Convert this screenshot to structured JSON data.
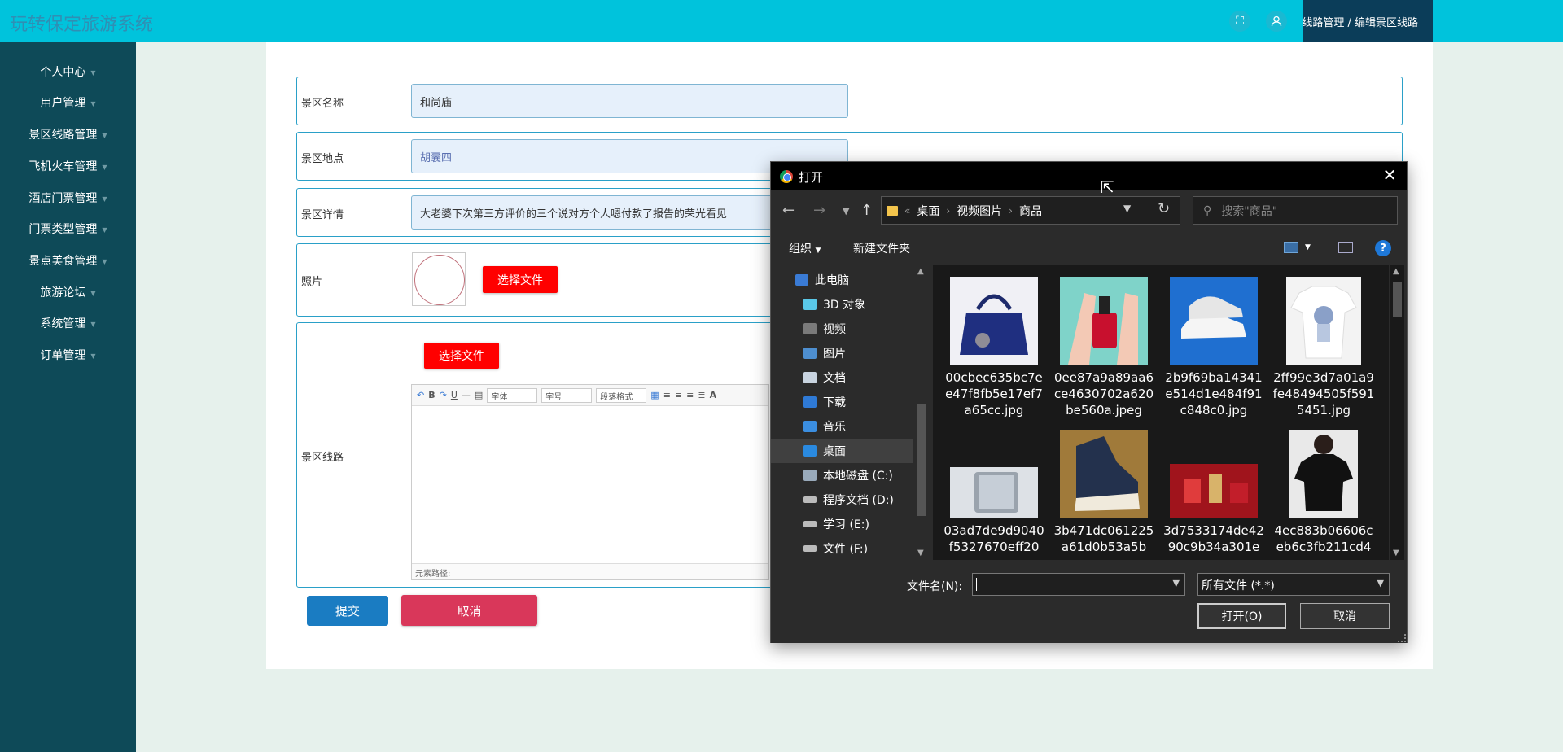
{
  "app": {
    "title": "玩转保定旅游系统"
  },
  "header": {
    "breadcrumb": "景区线路管理 / 编辑景区线路",
    "icons": [
      "fullscreen-icon",
      "user-icon"
    ]
  },
  "sidebar": {
    "items": [
      {
        "label": "个人中心"
      },
      {
        "label": "用户管理"
      },
      {
        "label": "景区线路管理"
      },
      {
        "label": "飞机火车管理"
      },
      {
        "label": "酒店门票管理"
      },
      {
        "label": "门票类型管理"
      },
      {
        "label": "景点美食管理"
      },
      {
        "label": "旅游论坛"
      },
      {
        "label": "系统管理"
      },
      {
        "label": "订单管理"
      }
    ]
  },
  "form": {
    "name": {
      "label": "景区名称",
      "value": "和尚庙"
    },
    "location": {
      "label": "景区地点",
      "value": "胡囊四"
    },
    "detail": {
      "label": "景区详情",
      "value": "大老婆下次第三方评价的三个说对方个人嗯付款了报告的荣光看见"
    },
    "photo": {
      "label": "照片",
      "choose_label": "选择文件"
    },
    "route": {
      "label": "景区线路",
      "choose_label": "选择文件",
      "toolbar": {
        "font": "字体",
        "size": "字号",
        "format": "段落格式"
      },
      "status": "元素路径:"
    },
    "submit_label": "提交",
    "cancel_label": "取消"
  },
  "dialog": {
    "title": "打开",
    "path": [
      "桌面",
      "视频图片",
      "商品"
    ],
    "search_placeholder": "搜索\"商品\"",
    "organize_label": "组织",
    "new_folder_label": "新建文件夹",
    "nav": [
      {
        "label": "此电脑",
        "icon": "computer-icon",
        "color": "#3a7bd5"
      },
      {
        "label": "3D 对象",
        "icon": "3d-objects-icon",
        "color": "#5ac8e8"
      },
      {
        "label": "视频",
        "icon": "video-icon",
        "color": "#7a7a7a"
      },
      {
        "label": "图片",
        "icon": "pictures-icon",
        "color": "#4e8fd0"
      },
      {
        "label": "文档",
        "icon": "documents-icon",
        "color": "#c9d4e0"
      },
      {
        "label": "下载",
        "icon": "download-icon",
        "color": "#2f7ad6"
      },
      {
        "label": "音乐",
        "icon": "music-icon",
        "color": "#3b8ee0"
      },
      {
        "label": "桌面",
        "icon": "desktop-icon",
        "color": "#2a8ae0"
      },
      {
        "label": "本地磁盘 (C:)",
        "icon": "drive-c-icon",
        "color": "#9ab"
      },
      {
        "label": "程序文档 (D:)",
        "icon": "drive-icon",
        "color": "#bbb"
      },
      {
        "label": "学习 (E:)",
        "icon": "drive-icon",
        "color": "#bbb"
      },
      {
        "label": "文件 (F:)",
        "icon": "drive-icon",
        "color": "#bbb"
      }
    ],
    "selected_nav": 7,
    "files": [
      {
        "name": "00cbec635bc7ee47f8fb5e17ef7a65cc.jpg",
        "thumb": "handbag",
        "bg": "#f0f0f5"
      },
      {
        "name": "0ee87a9a89aa6ce4630702a620be560a.jpeg",
        "thumb": "nail-polish",
        "bg": "#7fd3c9"
      },
      {
        "name": "2b9f69ba14341e514d1e484f91c848c0.jpg",
        "thumb": "sneakers",
        "bg": "#1f6fd0"
      },
      {
        "name": "2ff99e3d7a01a9fe48494505f5915451.jpg",
        "thumb": "tshirt",
        "bg": "#f3f3f3"
      },
      {
        "name": "03ad7de9d9040f5327670eff20",
        "thumb": "phone",
        "bg": "#dde1e6"
      },
      {
        "name": "3b471dc061225a61d0b53a5b",
        "thumb": "hightop",
        "bg": "#a07a3a"
      },
      {
        "name": "3d7533174de4290c9b34a301e",
        "thumb": "cosmetics",
        "bg": "#a0141c"
      },
      {
        "name": "4ec883b06606ceb6c3fb211cd4",
        "thumb": "woman-tshirt",
        "bg": "#e9e9e9"
      }
    ],
    "filename_label": "文件名(N):",
    "filename_value": "",
    "filetype": "所有文件 (*.*)",
    "open_label": "打开(O)",
    "cancel_label": "取消"
  }
}
